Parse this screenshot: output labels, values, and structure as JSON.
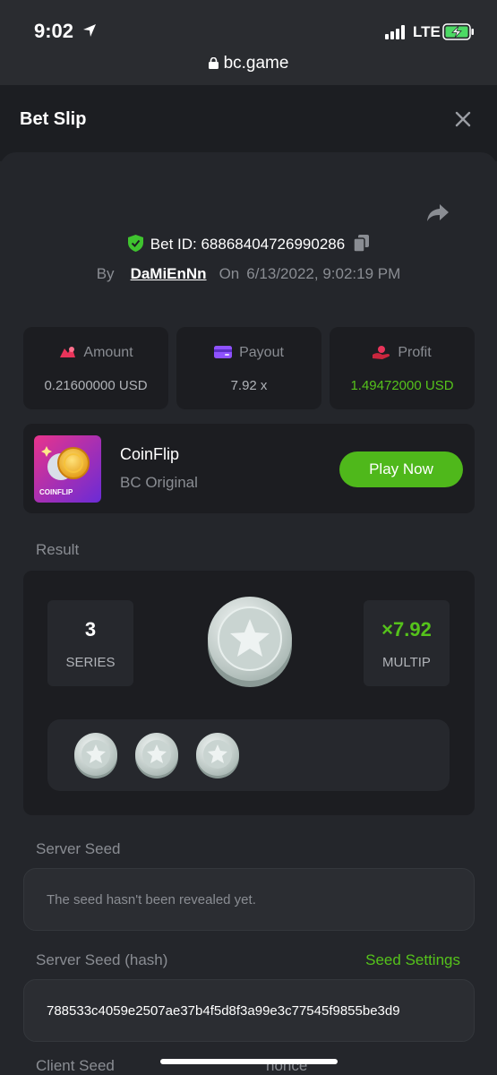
{
  "status_bar": {
    "time": "9:02",
    "network": "LTE"
  },
  "browser": {
    "url": "bc.game"
  },
  "header": {
    "title": "Bet Slip"
  },
  "bet": {
    "id_label": "Bet ID: 68868404726990286",
    "by_label": "By",
    "user": "DaMiEnNn",
    "on_label": "On",
    "date": "6/13/2022, 9:02:19 PM"
  },
  "stats": [
    {
      "label": "Amount",
      "value": "0.21600000 USD",
      "icon": "amount-icon",
      "color": "#e8345a"
    },
    {
      "label": "Payout",
      "value": "7.92 x",
      "icon": "payout-card-icon",
      "color": "#8f52ff"
    },
    {
      "label": "Profit",
      "value": "1.49472000 USD",
      "icon": "profit-hand-icon",
      "color": "#e8345a"
    }
  ],
  "game": {
    "name": "CoinFlip",
    "provider": "BC Original",
    "thumb_label": "COINFLIP",
    "play_label": "Play Now"
  },
  "result": {
    "section_label": "Result",
    "series_value": "3",
    "series_label": "SERIES",
    "multiplier_value": "×7.92",
    "multiplier_label": "MULTIP",
    "coins": [
      "silver-star",
      "silver-star",
      "silver-star"
    ]
  },
  "server_seed": {
    "label": "Server Seed",
    "value": "The seed hasn't been revealed yet."
  },
  "server_seed_hash": {
    "label": "Server Seed (hash)",
    "settings_label": "Seed Settings",
    "value": "788533c4059e2507ae37b4f5d8f3a99e3c77545f9855be3d9"
  },
  "client_seed": {
    "label": "Client Seed",
    "nonce_label": "nonce"
  },
  "colors": {
    "accent_green": "#55c21b",
    "button_green": "#4fb81b",
    "background": "#24262b",
    "card": "#1c1d21"
  }
}
